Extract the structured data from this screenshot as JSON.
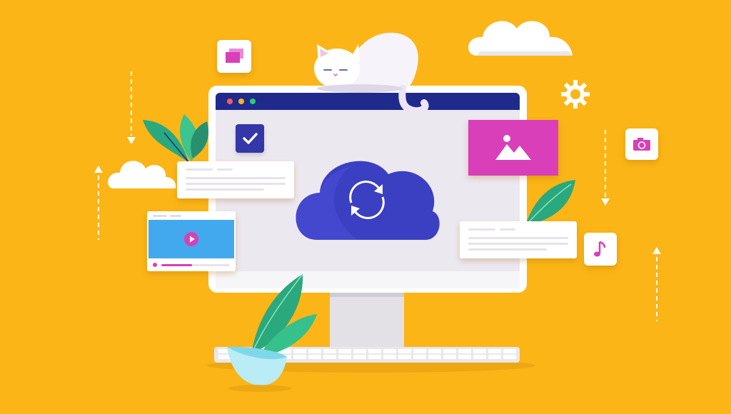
{
  "colors": {
    "background": "#fbb516",
    "screen": "#ece8ef",
    "browser_bar": "#1f2a8c",
    "cloud_blue": "#3b3fc2",
    "pink": "#d83fb8",
    "video_blue": "#43a9ee",
    "leaf_green": "#2aa87e",
    "checkbox": "#3337a8"
  },
  "icons": [
    "sync-icon",
    "checkmark-icon",
    "image-icon",
    "play-icon",
    "camera-icon",
    "music-note-icon",
    "gear-icon",
    "windows-icon",
    "cat-illustration",
    "leaf-decoration",
    "cloud-decoration"
  ],
  "browser": {
    "window_dots": [
      "#ff5a5a",
      "#ffb020",
      "#2ecc71"
    ]
  },
  "video_player": {
    "progress": 0.45
  }
}
